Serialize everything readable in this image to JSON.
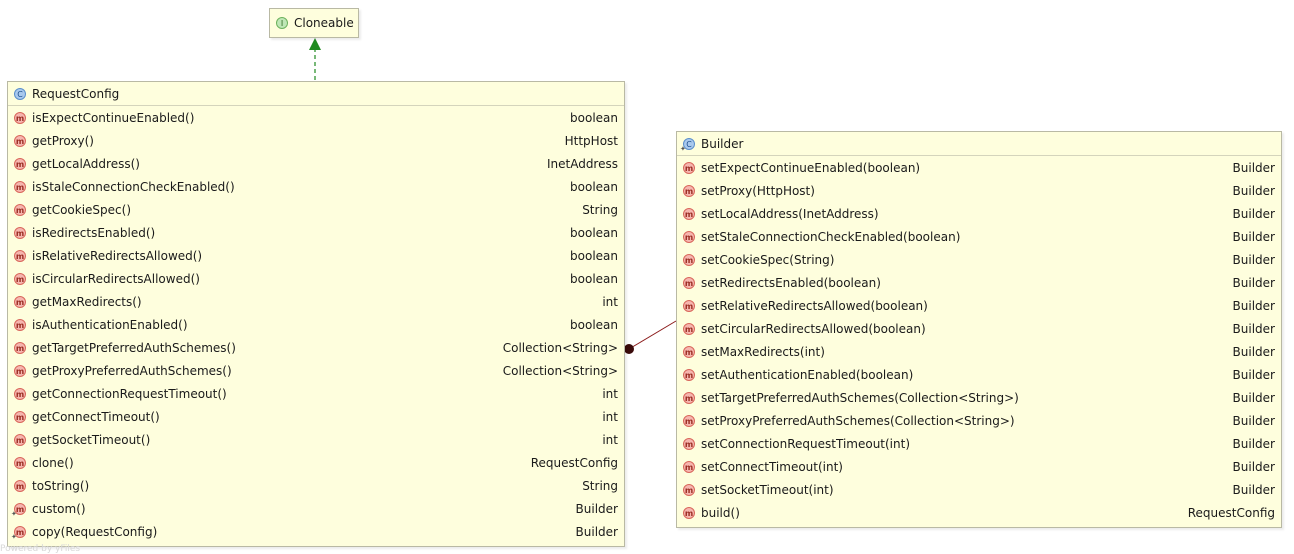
{
  "cloneable": {
    "badge": "I",
    "name": "Cloneable"
  },
  "request_config": {
    "badge": "C",
    "name": "RequestConfig",
    "methods": [
      {
        "badge": "m",
        "name": "isExpectContinueEnabled()",
        "type": "boolean"
      },
      {
        "badge": "m",
        "name": "getProxy()",
        "type": "HttpHost"
      },
      {
        "badge": "m",
        "name": "getLocalAddress()",
        "type": "InetAddress"
      },
      {
        "badge": "m",
        "name": "isStaleConnectionCheckEnabled()",
        "type": "boolean"
      },
      {
        "badge": "m",
        "name": "getCookieSpec()",
        "type": "String"
      },
      {
        "badge": "m",
        "name": "isRedirectsEnabled()",
        "type": "boolean"
      },
      {
        "badge": "m",
        "name": "isRelativeRedirectsAllowed()",
        "type": "boolean"
      },
      {
        "badge": "m",
        "name": "isCircularRedirectsAllowed()",
        "type": "boolean"
      },
      {
        "badge": "m",
        "name": "getMaxRedirects()",
        "type": "int"
      },
      {
        "badge": "m",
        "name": "isAuthenticationEnabled()",
        "type": "boolean"
      },
      {
        "badge": "m",
        "name": "getTargetPreferredAuthSchemes()",
        "type": "Collection<String>"
      },
      {
        "badge": "m",
        "name": "getProxyPreferredAuthSchemes()",
        "type": "Collection<String>"
      },
      {
        "badge": "m",
        "name": "getConnectionRequestTimeout()",
        "type": "int"
      },
      {
        "badge": "m",
        "name": "getConnectTimeout()",
        "type": "int"
      },
      {
        "badge": "m",
        "name": "getSocketTimeout()",
        "type": "int"
      },
      {
        "badge": "m",
        "name": "clone()",
        "type": "RequestConfig"
      },
      {
        "badge": "m",
        "name": "toString()",
        "type": "String"
      },
      {
        "badge": "m",
        "name": "custom()",
        "type": "Builder"
      },
      {
        "badge": "m",
        "name": "copy(RequestConfig)",
        "type": "Builder"
      }
    ]
  },
  "builder": {
    "badge": "C",
    "name": "Builder",
    "methods": [
      {
        "badge": "m",
        "name": "setExpectContinueEnabled(boolean)",
        "type": "Builder"
      },
      {
        "badge": "m",
        "name": "setProxy(HttpHost)",
        "type": "Builder"
      },
      {
        "badge": "m",
        "name": "setLocalAddress(InetAddress)",
        "type": "Builder"
      },
      {
        "badge": "m",
        "name": "setStaleConnectionCheckEnabled(boolean)",
        "type": "Builder"
      },
      {
        "badge": "m",
        "name": "setCookieSpec(String)",
        "type": "Builder"
      },
      {
        "badge": "m",
        "name": "setRedirectsEnabled(boolean)",
        "type": "Builder"
      },
      {
        "badge": "m",
        "name": "setRelativeRedirectsAllowed(boolean)",
        "type": "Builder"
      },
      {
        "badge": "m",
        "name": "setCircularRedirectsAllowed(boolean)",
        "type": "Builder"
      },
      {
        "badge": "m",
        "name": "setMaxRedirects(int)",
        "type": "Builder"
      },
      {
        "badge": "m",
        "name": "setAuthenticationEnabled(boolean)",
        "type": "Builder"
      },
      {
        "badge": "m",
        "name": "setTargetPreferredAuthSchemes(Collection<String>)",
        "type": "Builder"
      },
      {
        "badge": "m",
        "name": "setProxyPreferredAuthSchemes(Collection<String>)",
        "type": "Builder"
      },
      {
        "badge": "m",
        "name": "setConnectionRequestTimeout(int)",
        "type": "Builder"
      },
      {
        "badge": "m",
        "name": "setConnectTimeout(int)",
        "type": "Builder"
      },
      {
        "badge": "m",
        "name": "setSocketTimeout(int)",
        "type": "Builder"
      },
      {
        "badge": "m",
        "name": "build()",
        "type": "RequestConfig"
      }
    ]
  },
  "colors": {
    "box_fill": "#fefedd",
    "implements_arrow": "#1f8a1f",
    "inner_class_link": "#8b1a1a"
  },
  "watermark": "Powered by yFiles"
}
